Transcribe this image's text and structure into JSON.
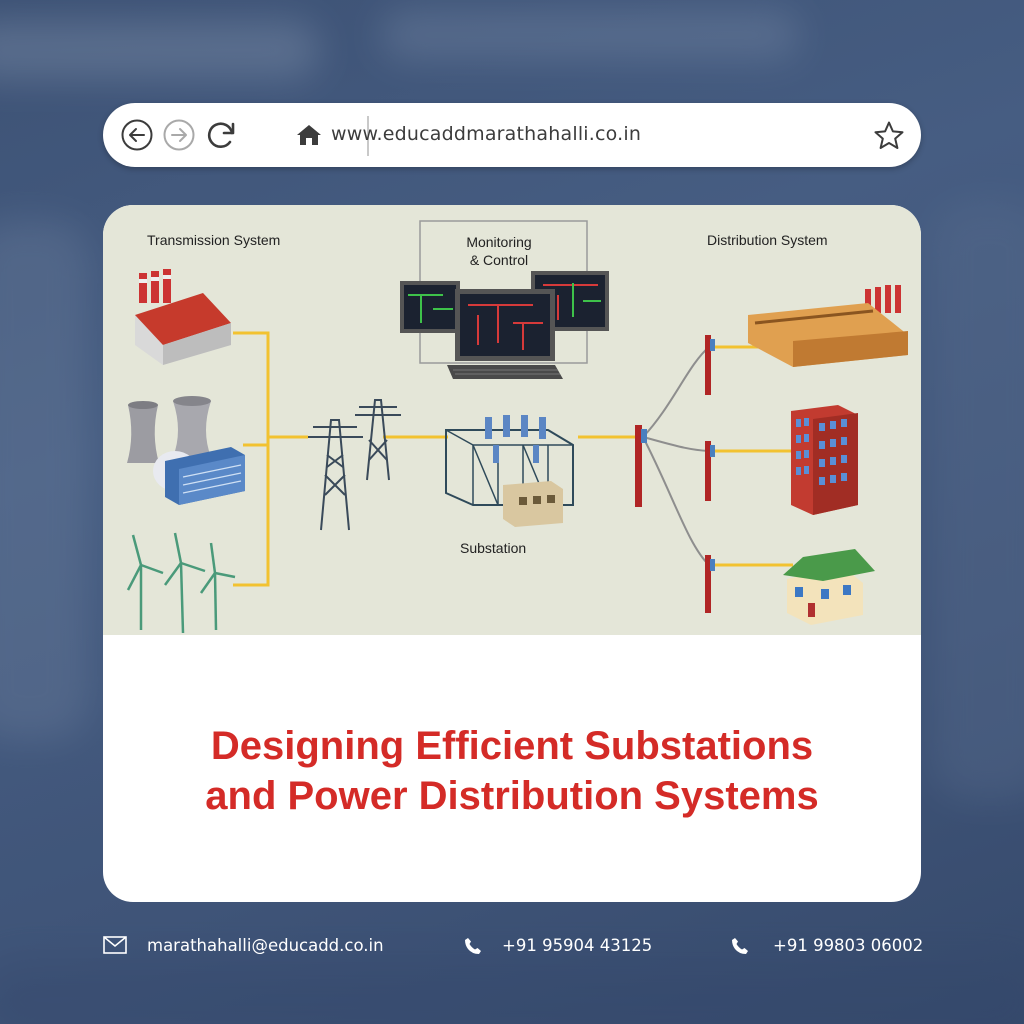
{
  "browser": {
    "url": "www.educaddmarathahalli.co.in",
    "icons": [
      "back-arrow-icon",
      "forward-arrow-icon",
      "reload-icon",
      "home-icon",
      "star-icon"
    ]
  },
  "diagram": {
    "labels": {
      "transmission": "Transmission System",
      "monitoring_line1": "Monitoring",
      "monitoring_line2": "& Control",
      "distribution": "Distribution System",
      "substation": "Substation"
    }
  },
  "headline": {
    "line1": "Designing Efficient Substations",
    "line2": "and Power Distribution Systems"
  },
  "footer": {
    "email": "marathahalli@educadd.co.in",
    "phone1": "+91 95904 43125",
    "phone2": "+91 99803 06002"
  },
  "colors": {
    "headline": "#d42b27",
    "background": "#465d82",
    "diagram_bg": "#e4e6d8",
    "power_line": "#f2c230"
  }
}
